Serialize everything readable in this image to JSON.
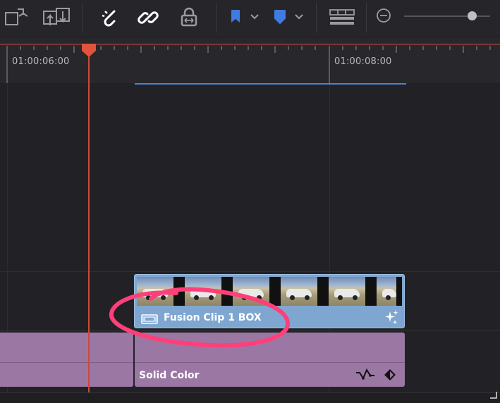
{
  "toolbar": {
    "buttons": [
      {
        "name": "overwrite-clip-icon"
      },
      {
        "name": "replace-clip-icon"
      },
      {
        "name": "snapping-icon"
      },
      {
        "name": "linked-selection-icon"
      },
      {
        "name": "position-lock-icon"
      },
      {
        "name": "flag-icon"
      },
      {
        "name": "flag-dropdown-icon"
      },
      {
        "name": "marker-icon"
      },
      {
        "name": "marker-dropdown-icon"
      },
      {
        "name": "timeline-view-options-icon"
      },
      {
        "name": "zoom-out-icon"
      }
    ],
    "accent_color": "#3f7be0",
    "zoom_slider_value": 0.74
  },
  "ruler": {
    "timecodes": [
      "01:00:06:00",
      "01:00:08:00"
    ],
    "playhead_color": "#d9503c",
    "in_out_color": "#4a86d2"
  },
  "clips": {
    "fusion": {
      "title": "Fusion Clip 1 BOX",
      "color": "#7fa6d0",
      "icon": "fusion-clip-icon",
      "badge_icon": "sparkle-icon",
      "thumbnail_count": 6
    },
    "solid": {
      "title": "Solid Color",
      "color": "#9b77a4",
      "icons": [
        "curve-icon",
        "keyframe-icon"
      ]
    }
  },
  "annotation": {
    "color": "#ff3f7a",
    "shape": "hand-drawn-ellipse"
  }
}
